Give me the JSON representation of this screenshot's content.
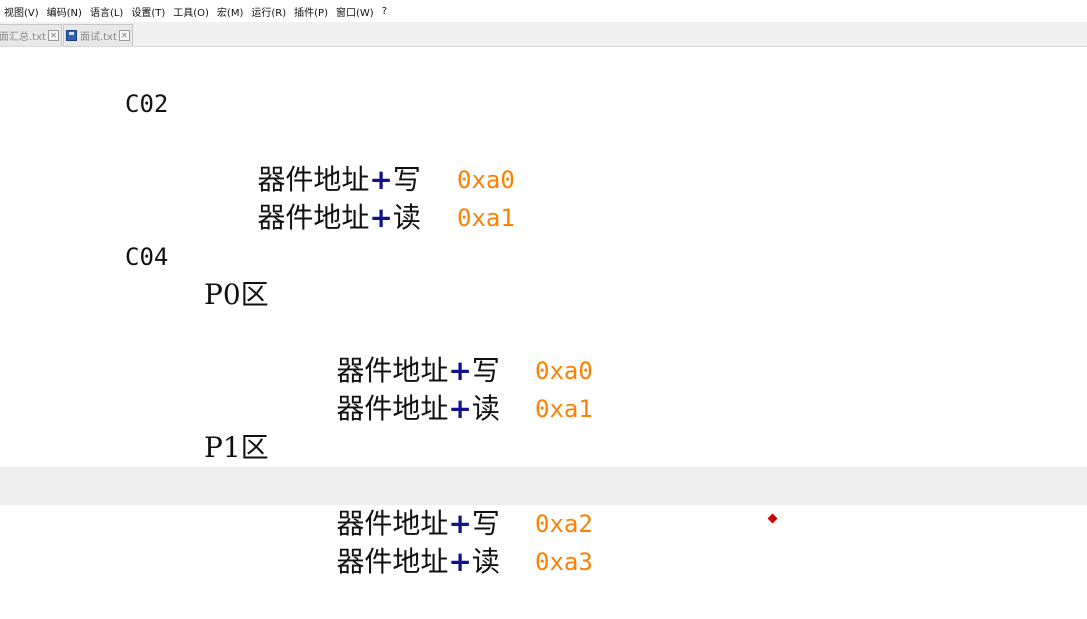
{
  "menubar": {
    "items": [
      "视图(V)",
      "编码(N)",
      "语言(L)",
      "设置(T)",
      "工具(O)",
      "宏(M)",
      "运行(R)",
      "插件(P)",
      "窗口(W)",
      "?"
    ]
  },
  "tabs": [
    {
      "label": "面汇总.txt",
      "close": "✕"
    },
    {
      "label": "面试.txt",
      "close": "✕"
    }
  ],
  "editor": {
    "lines": [
      {
        "text": "C02"
      },
      {
        "name": "器件地址",
        "plus": "+",
        "op": "写",
        "hex": "0xa0"
      },
      {
        "name": "器件地址",
        "plus": "+",
        "op": "读",
        "hex": "0xa1"
      },
      {
        "text": ""
      },
      {
        "text": "C04"
      },
      {
        "text": "P0区"
      },
      {
        "name": "器件地址",
        "plus": "+",
        "op": "写",
        "hex": "0xa0"
      },
      {
        "name": "器件地址",
        "plus": "+",
        "op": "读",
        "hex": "0xa1"
      },
      {
        "text": ""
      },
      {
        "text": "P1区"
      },
      {
        "name": "器件地址",
        "plus": "+",
        "op": "写",
        "hex": "0xa2"
      },
      {
        "name": "器件地址",
        "plus": "+",
        "op": "读",
        "hex": "0xa3"
      }
    ]
  },
  "colors": {
    "hex_value": "#ff8000",
    "operator_plus": "#12128a",
    "current_line": "#eeeeee"
  }
}
